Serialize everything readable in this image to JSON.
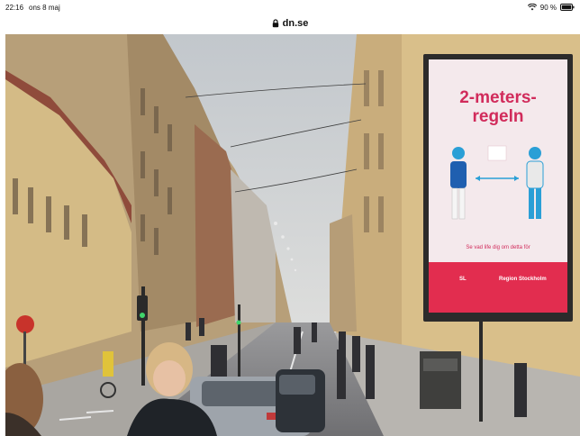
{
  "status_bar": {
    "time": "22:16",
    "date": "ons 8 maj",
    "battery_text": "90 %"
  },
  "address_bar": {
    "domain": "dn.se"
  },
  "photo": {
    "billboard": {
      "headline": "2-meters-\nregeln",
      "caption": "Se vad life dig om detta för",
      "footer_text": "Region Stockholm"
    }
  },
  "colors": {
    "billboard_pink": "#d12b5b",
    "billboard_red": "#e22d4f",
    "figure_blue": "#2a9fd6"
  },
  "icons": [
    "lock-icon",
    "wifi-icon",
    "battery-icon"
  ]
}
